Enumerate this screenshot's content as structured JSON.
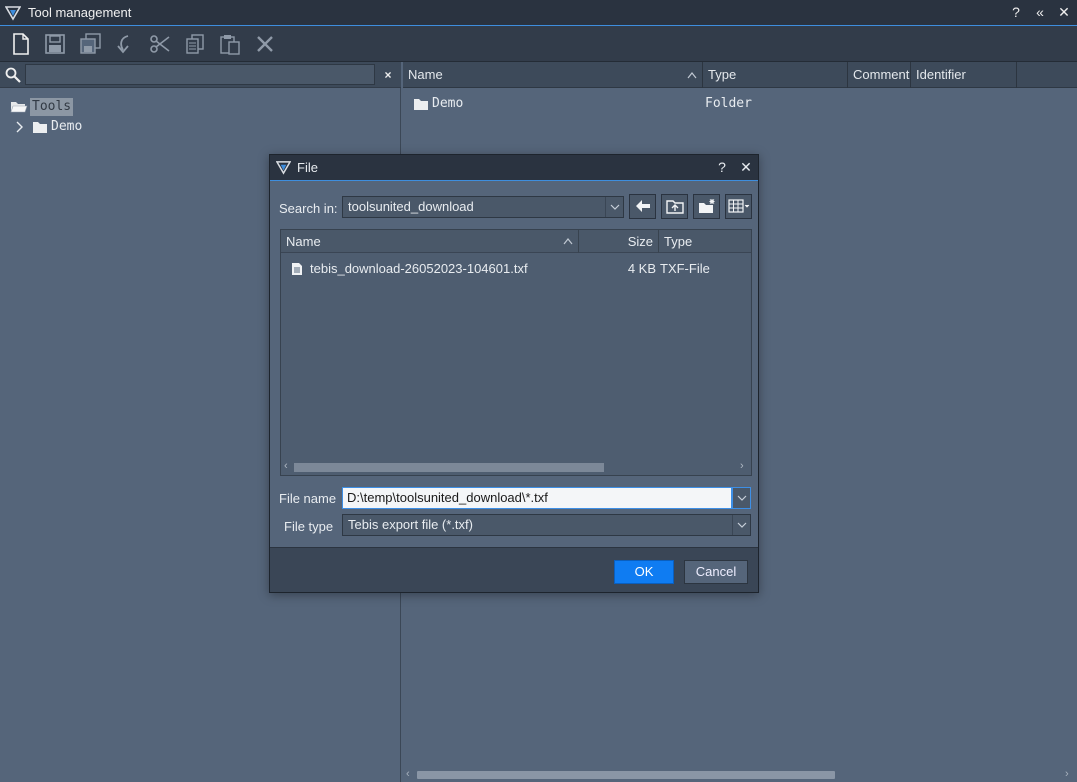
{
  "window": {
    "title": "Tool management",
    "help": "?",
    "collapse": "«",
    "close": "✕"
  },
  "toolbar": {
    "items": [
      "new-document",
      "save",
      "save-all",
      "import",
      "cut",
      "copy",
      "paste",
      "delete"
    ]
  },
  "left": {
    "search_placeholder": "",
    "clear": "×",
    "tree": {
      "root": "Tools",
      "child": "Demo",
      "expander": "›"
    }
  },
  "right": {
    "columns": [
      "Name",
      "Type",
      "Comment",
      "Identifier"
    ],
    "rows": [
      {
        "name": "Demo",
        "type": "Folder"
      }
    ]
  },
  "dialog": {
    "title": "File",
    "help": "?",
    "close": "✕",
    "search_in_label": "Search in:",
    "search_in_value": "toolsunited_download",
    "file_columns": [
      "Name",
      "Size",
      "Type"
    ],
    "files": [
      {
        "name": "tebis_download-26052023-104601.txf",
        "size": "4 KB",
        "type": "TXF-File"
      }
    ],
    "file_name_label": "File name",
    "file_name_value": "D:\\temp\\toolsunited_download\\*.txf",
    "file_type_label": "File type",
    "file_type_value": "Tebis export file (*.txf)",
    "ok": "OK",
    "cancel": "Cancel"
  },
  "colors": {
    "accent": "#3e8ede",
    "ok_button": "#0f7cf2",
    "background": "#55657a",
    "titlebar": "#2a3340"
  }
}
